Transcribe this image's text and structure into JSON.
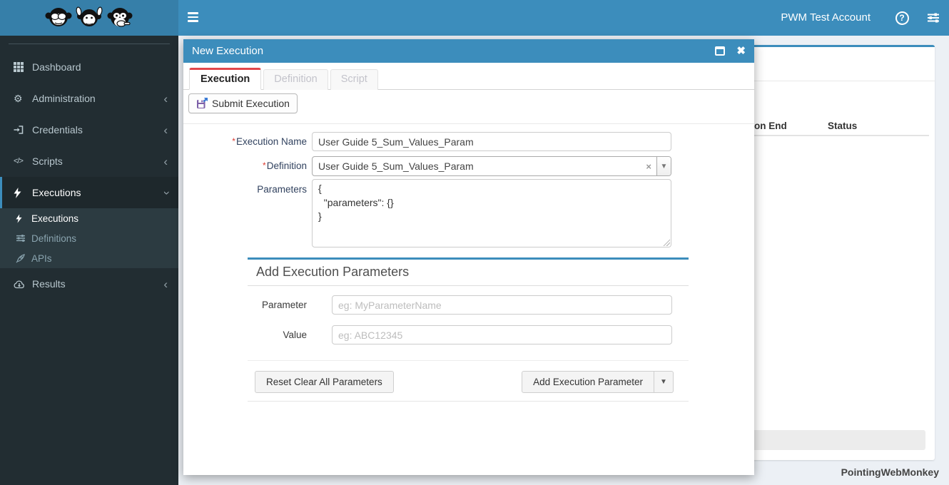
{
  "navbar": {
    "account": "PWM Test Account"
  },
  "sidebar": {
    "items": [
      {
        "label": "Dashboard"
      },
      {
        "label": "Administration"
      },
      {
        "label": "Credentials"
      },
      {
        "label": "Scripts"
      },
      {
        "label": "Executions"
      },
      {
        "label": "Results"
      }
    ],
    "submenu": [
      {
        "label": "Executions"
      },
      {
        "label": "Definitions"
      },
      {
        "label": "APIs"
      }
    ]
  },
  "modal": {
    "title": "New Execution",
    "tabs": [
      {
        "label": "Execution"
      },
      {
        "label": "Definition"
      },
      {
        "label": "Script"
      }
    ],
    "toolbar": {
      "submit_label": "Submit Execution"
    },
    "form": {
      "required_marker": "*",
      "execution_name_label": "Execution Name",
      "execution_name_value": "User Guide 5_Sum_Values_Param",
      "definition_label": "Definition",
      "definition_value": "User Guide 5_Sum_Values_Param",
      "parameters_label": "Parameters",
      "parameters_value": "{\n  \"parameters\": {}\n}"
    },
    "add_params": {
      "heading": "Add Execution Parameters",
      "parameter_label": "Parameter",
      "parameter_placeholder": "eg: MyParameterName",
      "value_label": "Value",
      "value_placeholder": "eg: ABC12345",
      "reset_label": "Reset Clear All Parameters",
      "add_label": "Add Execution Parameter"
    }
  },
  "background_page": {
    "table_headers": {
      "col_end": "on End",
      "col_status": "Status"
    }
  },
  "footer": {
    "brand": "PointingWebMonkey"
  },
  "colors": {
    "accent_blue": "#3c8dbc",
    "logo_blue": "#367fa9",
    "sidebar_dark": "#222d32",
    "submenu_dark": "#2c3b41",
    "tab_active_red": "#e2474b"
  },
  "icons": {
    "navbar": [
      "hamburger-icon",
      "question-circle-icon",
      "sliders-icon",
      "monkeys-logo"
    ],
    "sidebar": [
      "grid-icon",
      "gears-icon",
      "sign-in-icon",
      "code-icon",
      "bolt-icon",
      "sliders-icon",
      "rocket-icon",
      "cloud-download-icon",
      "chevron-left-icon",
      "chevron-down-icon"
    ],
    "modal": [
      "maximize-icon",
      "close-icon",
      "save-icon",
      "clear-x-icon",
      "dropdown-caret-icon"
    ]
  }
}
